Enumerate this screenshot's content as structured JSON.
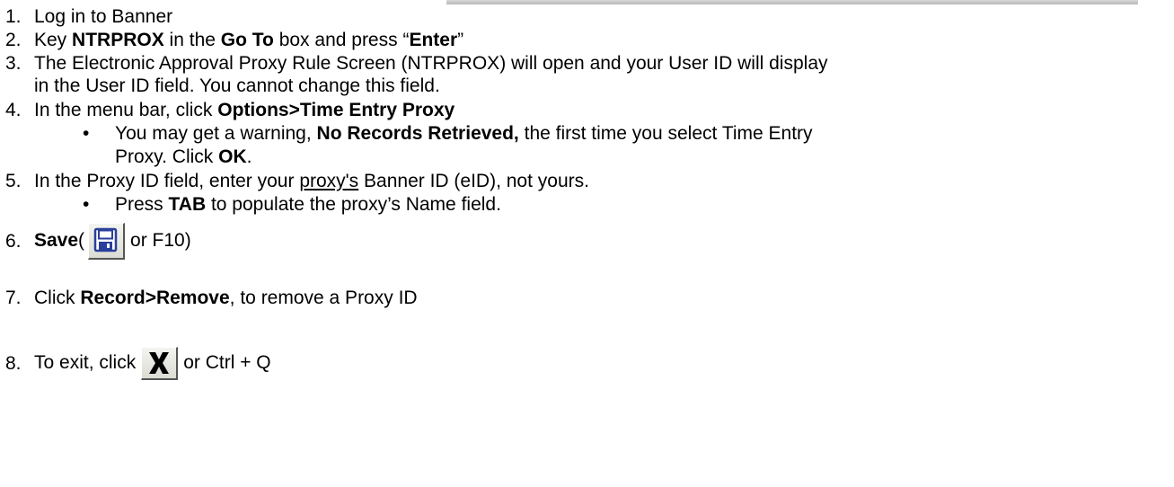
{
  "steps": {
    "s1": {
      "num": "1.",
      "text": "Log in to Banner"
    },
    "s2": {
      "num": "2.",
      "a": "Key ",
      "b1": "NTRPROX",
      "c": " in the ",
      "b2": "Go To",
      "d": " box and press “",
      "b3": "Enter",
      "e": "”"
    },
    "s3": {
      "num": "3.",
      "line1": "The Electronic Approval Proxy Rule Screen (NTRPROX) will open and your User ID will display",
      "line2": "in the User ID field. You cannot change this field."
    },
    "s4": {
      "num": "4.",
      "a": "In the menu bar, click ",
      "b": "Options>Time Entry Proxy",
      "bullet": {
        "a": "You may get a warning, ",
        "b": "No Records Retrieved,",
        "c": " the first time you select Time Entry",
        "line2a": "Proxy. Click ",
        "line2b": "OK",
        "line2c": "."
      }
    },
    "s5": {
      "num": "5.",
      "a": "In the Proxy ID field, enter your ",
      "u": "proxy's",
      "b": " Banner ID (eID), not yours.",
      "bullet": {
        "a": "Press ",
        "b": "TAB",
        "c": " to populate the proxy’s Name field."
      }
    },
    "s6": {
      "num": "6.",
      "b": "Save",
      "a": " (",
      "c": "or F10)"
    },
    "s7": {
      "num": "7.",
      "a": "Click ",
      "b": "Record>Remove",
      "c": ", to remove a Proxy ID"
    },
    "s8": {
      "num": "8.",
      "a": "To exit, click ",
      "c": "or Ctrl + Q"
    }
  },
  "bullet_glyph": "•",
  "icons": {
    "save": "floppy-disk-save-icon",
    "exit": "x-exit-icon"
  },
  "colors": {
    "text": "#000000",
    "floppy": "#2a3f9a",
    "icon_bg": "#e6e6de"
  }
}
